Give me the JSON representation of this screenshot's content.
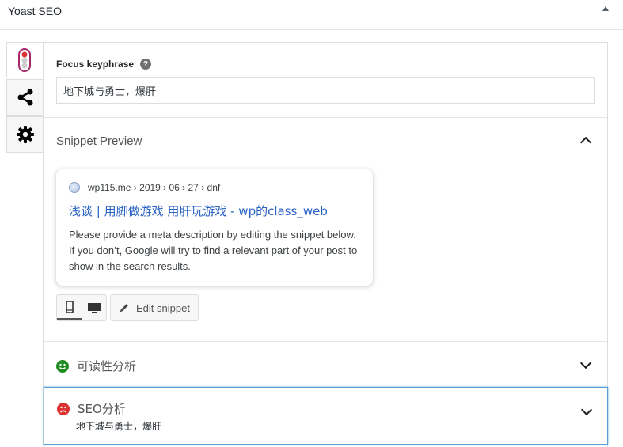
{
  "metabox": {
    "title": "Yoast SEO"
  },
  "tabs": [
    {
      "icon": "traffic-light-icon"
    },
    {
      "icon": "share-icon"
    },
    {
      "icon": "gear-icon"
    }
  ],
  "focus_keyphrase": {
    "label": "Focus keyphrase",
    "help": "?",
    "value": "地下城与勇士，爆肝"
  },
  "snippet": {
    "heading": "Snippet Preview",
    "breadcrumb": "wp115.me › 2019 › 06 › 27 › dnf",
    "title": "浅谈 | 用脚做游戏 用肝玩游戏 - wp的class_web",
    "description": "Please provide a meta description by editing the snippet below. If you don’t, Google will try to find a relevant part of your post to show in the search results.",
    "edit_label": "Edit snippet"
  },
  "readability": {
    "heading": "可读性分析",
    "status_color": "#1e8c1e"
  },
  "seo": {
    "heading": "SEO分析",
    "subtitle": "地下城与勇士，爆肝",
    "status_color": "#dc3232"
  }
}
